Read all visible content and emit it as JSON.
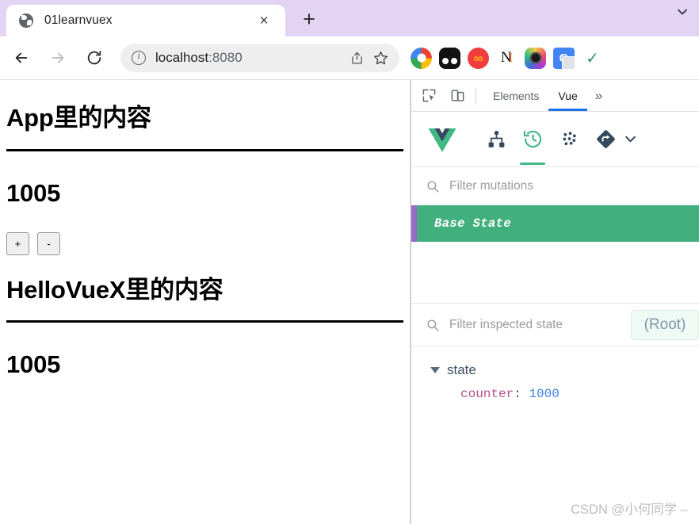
{
  "browser": {
    "tab": {
      "title": "01learnvuex",
      "favicon": "globe-icon",
      "close": "×"
    },
    "new_tab_label": "+",
    "window_chevron": "chevron-down-icon",
    "toolbar": {
      "back": "back-arrow-icon",
      "forward": "forward-arrow-icon",
      "reload": "reload-icon",
      "url_host": "localhost",
      "url_port": ":8080",
      "url_full": "localhost:8080",
      "info_icon": "site-info-icon",
      "share_icon": "share-icon",
      "bookmark_icon": "star-icon"
    },
    "extensions": [
      {
        "name": "google-color-ring-extension",
        "label": ""
      },
      {
        "name": "dark-dots-extension",
        "label": ""
      },
      {
        "name": "infinity-extension",
        "label": "∞"
      },
      {
        "name": "n-serif-extension",
        "label": "N"
      },
      {
        "name": "camera-extension",
        "label": ""
      },
      {
        "name": "google-translate-extension",
        "label": "G"
      },
      {
        "name": "green-check-extension",
        "label": "✓"
      }
    ]
  },
  "page": {
    "app_heading": "App里的内容",
    "app_counter": "1005",
    "increment_label": "+",
    "decrement_label": "-",
    "hello_heading": "HelloVueX里的内容",
    "hello_counter": "1005"
  },
  "devtools": {
    "inspect_icon": "inspect-element-icon",
    "device_icon": "device-toolbar-icon",
    "tabs": [
      {
        "label": "Elements",
        "active": false
      },
      {
        "label": "Vue",
        "active": true
      }
    ],
    "more_label": "»",
    "vue_toolbar": {
      "logo": "vue-logo-icon",
      "items": [
        {
          "name": "components-tree-icon",
          "active": false
        },
        {
          "name": "vuex-history-icon",
          "active": true
        },
        {
          "name": "events-dots-icon",
          "active": false
        },
        {
          "name": "routing-diamond-icon",
          "active": false
        }
      ],
      "chevron": "chevron-down-icon"
    },
    "mutations_filter_placeholder": "Filter mutations",
    "mutations": [
      {
        "label": "Base State",
        "selected": true
      }
    ],
    "inspected_filter_placeholder": "Filter inspected state",
    "root_button_label": "(Root)",
    "state_tree": {
      "root_key": "state",
      "expanded": true,
      "entries": [
        {
          "key": "counter",
          "separator": ":",
          "value": "1000"
        }
      ]
    },
    "watermark": "CSDN @小何同学 –"
  },
  "colors": {
    "lavender_chrome": "#e3d4f4",
    "vue_green": "#42b883",
    "mutation_green": "#42b07e",
    "mutation_purple": "#9769c9",
    "devtools_blue": "#1a73e8"
  }
}
